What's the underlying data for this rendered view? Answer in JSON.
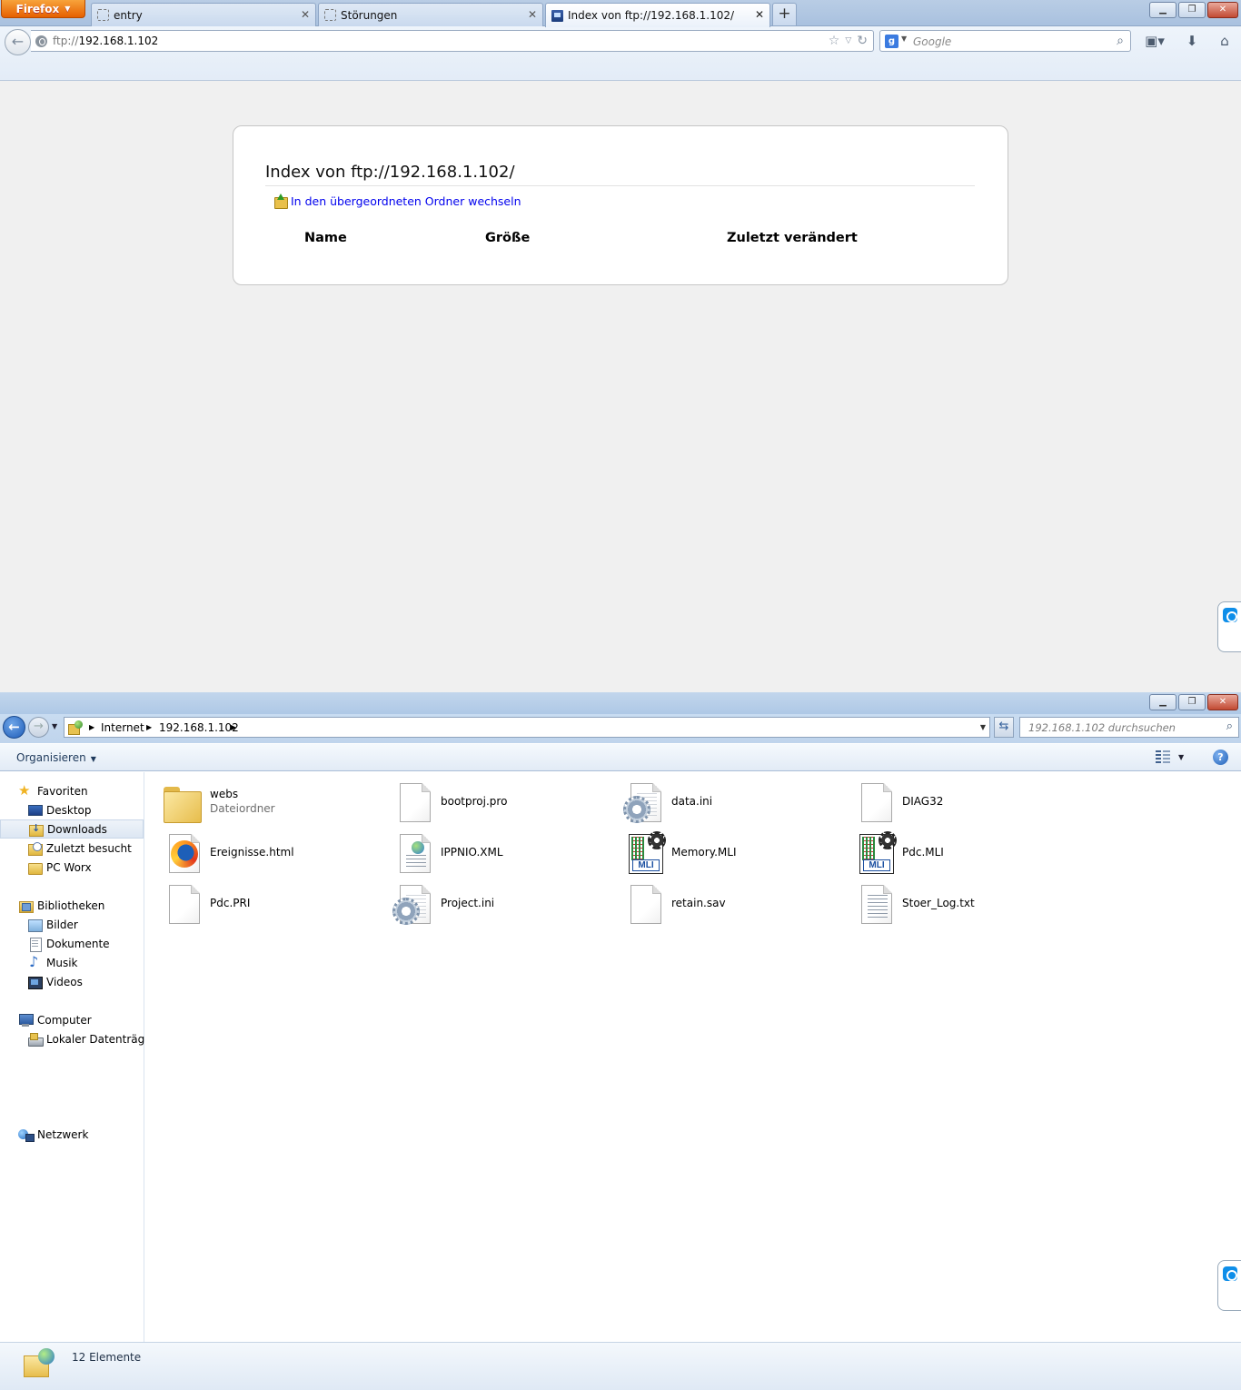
{
  "firefox": {
    "menu_label": "Firefox",
    "tabs": [
      {
        "label": "entry"
      },
      {
        "label": "Störungen"
      },
      {
        "label": "Index von ftp://192.168.1.102/"
      }
    ],
    "url": {
      "scheme": "ftp://",
      "host": "192.168.1.102"
    },
    "search_placeholder": "Google",
    "page": {
      "title": "Index von ftp://192.168.1.102/",
      "parent_link": "In den übergeordneten Ordner wechseln",
      "columns": [
        "Name",
        "Größe",
        "Zuletzt verändert"
      ]
    }
  },
  "explorer": {
    "breadcrumb": [
      "Internet",
      "192.168.1.102"
    ],
    "search_placeholder": "192.168.1.102 durchsuchen",
    "organize_label": "Organisieren",
    "nav": {
      "favorites": {
        "label": "Favoriten",
        "items": [
          "Desktop",
          "Downloads",
          "Zuletzt besucht",
          "PC Worx"
        ]
      },
      "libraries": {
        "label": "Bibliotheken",
        "items": [
          "Bilder",
          "Dokumente",
          "Musik",
          "Videos"
        ]
      },
      "computer": {
        "label": "Computer",
        "items": [
          "Lokaler Datenträger"
        ]
      },
      "network": {
        "label": "Netzwerk"
      }
    },
    "files": [
      {
        "name": "webs",
        "sub": "Dateiordner",
        "icon": "folder-icon"
      },
      {
        "name": "bootproj.pro",
        "icon": "blank-file-icon"
      },
      {
        "name": "data.ini",
        "icon": "settings-file-icon"
      },
      {
        "name": "DIAG32",
        "icon": "blank-file-icon"
      },
      {
        "name": "Ereignisse.html",
        "icon": "firefox-html-icon"
      },
      {
        "name": "IPPNIO.XML",
        "icon": "xml-file-icon"
      },
      {
        "name": "Memory.MLI",
        "icon": "mli-file-icon"
      },
      {
        "name": "Pdc.MLI",
        "icon": "mli-file-icon"
      },
      {
        "name": "Pdc.PRI",
        "icon": "blank-file-icon"
      },
      {
        "name": "Project.ini",
        "icon": "settings-file-icon"
      },
      {
        "name": "retain.sav",
        "icon": "blank-file-icon"
      },
      {
        "name": "Stoer_Log.txt",
        "icon": "text-file-icon"
      }
    ],
    "status_text": "12 Elemente",
    "mli_label": "MLI"
  }
}
